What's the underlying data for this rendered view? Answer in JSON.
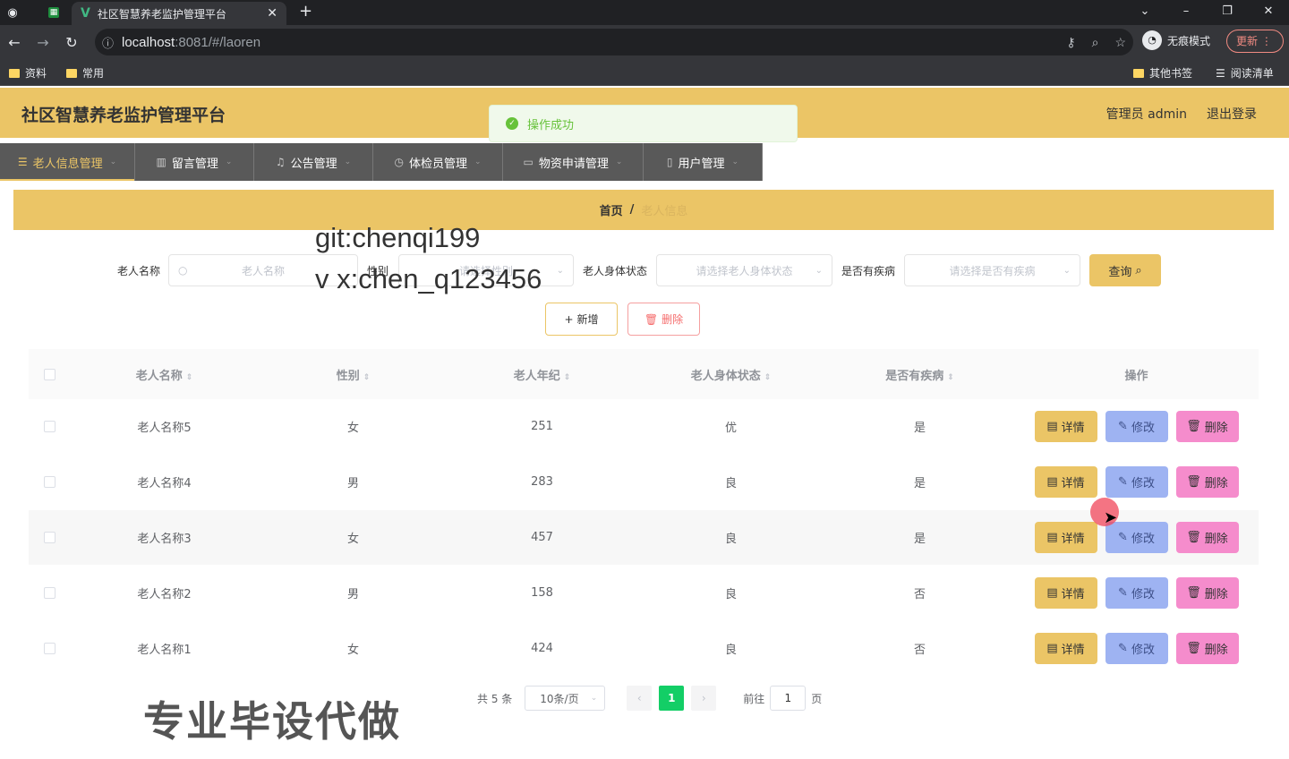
{
  "browser": {
    "tab_title": "社区智慧养老监护管理平台",
    "url_host": "localhost",
    "url_rest": ":8081/#/laoren",
    "incognito_label": "无痕模式",
    "update_label": "更新",
    "bookmarks": [
      "资料",
      "常用"
    ],
    "bookmarks_right": [
      "其他书签",
      "阅读清单"
    ]
  },
  "header": {
    "title": "社区智慧养老监护管理平台",
    "user": "管理员 admin",
    "logout": "退出登录"
  },
  "nav": [
    {
      "label": "老人信息管理",
      "icon": "menu-icon"
    },
    {
      "label": "留言管理",
      "icon": "chart-icon"
    },
    {
      "label": "公告管理",
      "icon": "bell-icon"
    },
    {
      "label": "体检员管理",
      "icon": "clock-icon"
    },
    {
      "label": "物资申请管理",
      "icon": "card-icon"
    },
    {
      "label": "用户管理",
      "icon": "phone-icon"
    }
  ],
  "toast": {
    "message": "操作成功"
  },
  "breadcrumb": {
    "home": "首页",
    "separator": "/",
    "current": "老人信息"
  },
  "search": {
    "name_label": "老人名称",
    "name_placeholder": "老人名称",
    "sex_label": "性别",
    "sex_placeholder": "请选择性别",
    "state_label": "老人身体状态",
    "state_placeholder": "请选择老人身体状态",
    "ill_label": "是否有疾病",
    "ill_placeholder": "请选择是否有疾病",
    "query_button": "查询"
  },
  "actions": {
    "add": "新增",
    "delete": "删除"
  },
  "watermark": {
    "line1": "git:chenqi199",
    "line2": "v x:chen_q123456",
    "line3": "专业毕设代做"
  },
  "table": {
    "headers": [
      "老人名称",
      "性别",
      "老人年纪",
      "老人身体状态",
      "是否有疾病",
      "操作"
    ],
    "rows": [
      [
        "老人名称5",
        "女",
        "251",
        "优",
        "是"
      ],
      [
        "老人名称4",
        "男",
        "283",
        "良",
        "是"
      ],
      [
        "老人名称3",
        "女",
        "457",
        "良",
        "是"
      ],
      [
        "老人名称2",
        "男",
        "158",
        "良",
        "否"
      ],
      [
        "老人名称1",
        "女",
        "424",
        "良",
        "否"
      ]
    ],
    "op_labels": {
      "detail": "详情",
      "edit": "修改",
      "delete": "删除"
    }
  },
  "pagination": {
    "total": "共 5 条",
    "page_size": "10条/页",
    "current_page": "1",
    "goto_label": "前往",
    "goto_value": "1",
    "page_suffix": "页"
  },
  "colors": {
    "accent": "#ebc566",
    "nav_bg": "#595959",
    "success": "#67c23a",
    "page_active": "#13ce66"
  }
}
